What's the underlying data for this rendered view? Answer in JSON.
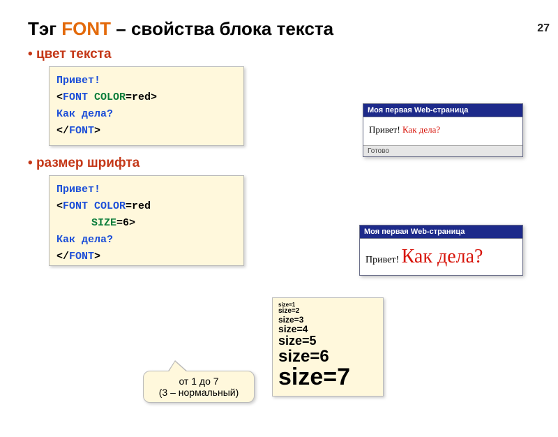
{
  "page_number": "27",
  "title": {
    "part1": "Тэг ",
    "highlight": "FONT",
    "part2": " – свойства блока текста"
  },
  "bullet1": "цвет текста",
  "bullet2": "размер шрифта",
  "code1": {
    "l1": "Привет!",
    "l2a": "<",
    "l2b": "FONT ",
    "l2c": "COLOR",
    "l2d": "=red>",
    "l3": "Как дела?",
    "l4a": "</",
    "l4b": "FONT",
    "l4c": ">"
  },
  "code2": {
    "l1": "Привет!",
    "l2a": "<",
    "l2b": "FONT COLOR",
    "l2c": "=red",
    "l3a": "SIZE",
    "l3b": "=6>",
    "l4": "Как дела?",
    "l5a": "</",
    "l5b": "FONT",
    "l5c": ">"
  },
  "preview1": {
    "title": "Моя первая Web-страница",
    "text_black": "Привет! ",
    "text_red": "Как дела?",
    "status": "Готово"
  },
  "preview2": {
    "title": "Моя первая Web-страница",
    "text_black": "Привет! ",
    "text_red": "Как дела?"
  },
  "sizes": {
    "s1": "size=1",
    "s2": "size=2",
    "s3": "size=3",
    "s4": "size=4",
    "s5": "size=5",
    "s6": "size=6",
    "s7": "size=7"
  },
  "callout": {
    "l1": "от 1 до 7",
    "l2": "(3 – нормальный)"
  }
}
